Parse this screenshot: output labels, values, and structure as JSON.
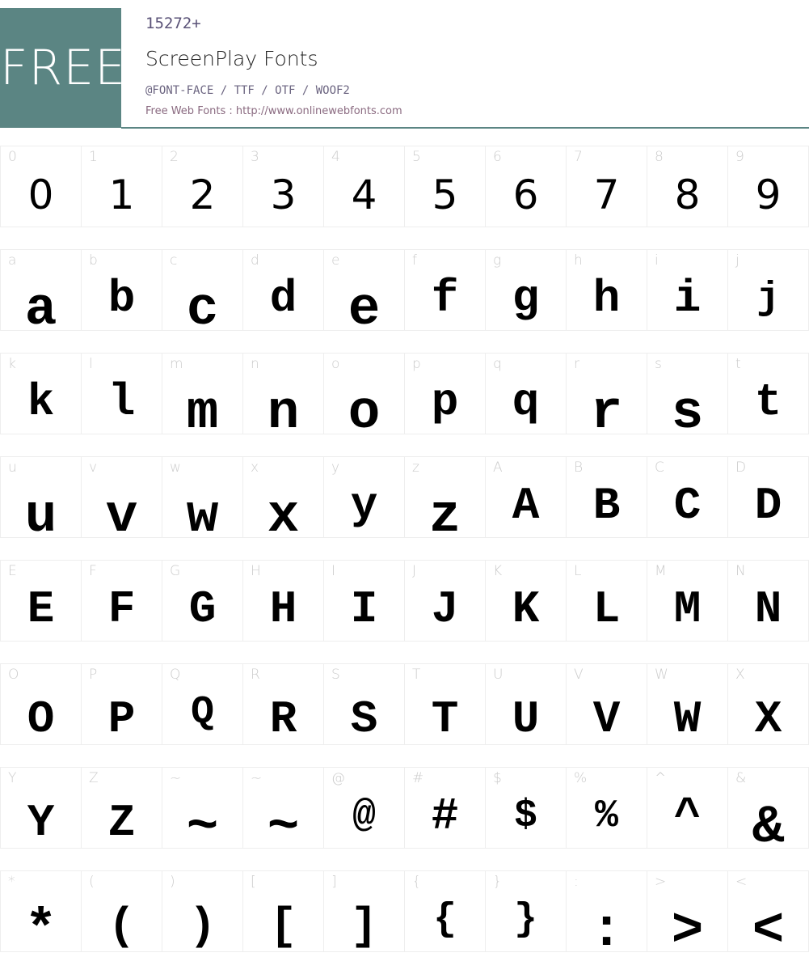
{
  "header": {
    "badge": "FREE",
    "count": "15272+",
    "title": "ScreenPlay Fonts",
    "formats": "@FONT-FACE / TTF / OTF / WOOF2",
    "site_link": "Free Web Fonts : http://www.onlinewebfonts.com"
  },
  "colors": {
    "accent": "#5b8583",
    "label": "#cccccc",
    "glyph": "#000000"
  },
  "rows": [
    [
      {
        "l": "0",
        "g": "0",
        "s": "digit"
      },
      {
        "l": "1",
        "g": "1",
        "s": "digit"
      },
      {
        "l": "2",
        "g": "2",
        "s": "digit"
      },
      {
        "l": "3",
        "g": "3",
        "s": "digit"
      },
      {
        "l": "4",
        "g": "4",
        "s": "digit"
      },
      {
        "l": "5",
        "g": "5",
        "s": "digit"
      },
      {
        "l": "6",
        "g": "6",
        "s": "digit"
      },
      {
        "l": "7",
        "g": "7",
        "s": "digit"
      },
      {
        "l": "8",
        "g": "8",
        "s": "digit"
      },
      {
        "l": "9",
        "g": "9",
        "s": "digit"
      }
    ],
    [
      {
        "l": "a",
        "g": "a",
        "s": "big"
      },
      {
        "l": "b",
        "g": "b",
        "s": ""
      },
      {
        "l": "c",
        "g": "c",
        "s": "big"
      },
      {
        "l": "d",
        "g": "d",
        "s": ""
      },
      {
        "l": "e",
        "g": "e",
        "s": "big"
      },
      {
        "l": "f",
        "g": "f",
        "s": ""
      },
      {
        "l": "g",
        "g": "g",
        "s": ""
      },
      {
        "l": "h",
        "g": "h",
        "s": ""
      },
      {
        "l": "i",
        "g": "i",
        "s": ""
      },
      {
        "l": "j",
        "g": "j",
        "s": "small"
      }
    ],
    [
      {
        "l": "k",
        "g": "k",
        "s": ""
      },
      {
        "l": "l",
        "g": "l",
        "s": ""
      },
      {
        "l": "m",
        "g": "m",
        "s": "big"
      },
      {
        "l": "n",
        "g": "n",
        "s": "big"
      },
      {
        "l": "o",
        "g": "o",
        "s": "big"
      },
      {
        "l": "p",
        "g": "p",
        "s": ""
      },
      {
        "l": "q",
        "g": "q",
        "s": ""
      },
      {
        "l": "r",
        "g": "r",
        "s": "big"
      },
      {
        "l": "s",
        "g": "s",
        "s": "big"
      },
      {
        "l": "t",
        "g": "t",
        "s": ""
      }
    ],
    [
      {
        "l": "u",
        "g": "u",
        "s": "big"
      },
      {
        "l": "v",
        "g": "v",
        "s": "big"
      },
      {
        "l": "w",
        "g": "w",
        "s": "big"
      },
      {
        "l": "x",
        "g": "x",
        "s": "big"
      },
      {
        "l": "y",
        "g": "y",
        "s": ""
      },
      {
        "l": "z",
        "g": "z",
        "s": "big"
      },
      {
        "l": "A",
        "g": "A",
        "s": ""
      },
      {
        "l": "B",
        "g": "B",
        "s": ""
      },
      {
        "l": "C",
        "g": "C",
        "s": ""
      },
      {
        "l": "D",
        "g": "D",
        "s": ""
      }
    ],
    [
      {
        "l": "E",
        "g": "E",
        "s": ""
      },
      {
        "l": "F",
        "g": "F",
        "s": ""
      },
      {
        "l": "G",
        "g": "G",
        "s": ""
      },
      {
        "l": "H",
        "g": "H",
        "s": ""
      },
      {
        "l": "I",
        "g": "I",
        "s": ""
      },
      {
        "l": "J",
        "g": "J",
        "s": ""
      },
      {
        "l": "K",
        "g": "K",
        "s": ""
      },
      {
        "l": "L",
        "g": "L",
        "s": ""
      },
      {
        "l": "M",
        "g": "M",
        "s": ""
      },
      {
        "l": "N",
        "g": "N",
        "s": ""
      }
    ],
    [
      {
        "l": "O",
        "g": "O",
        "s": "low"
      },
      {
        "l": "P",
        "g": "P",
        "s": "low"
      },
      {
        "l": "Q",
        "g": "Q",
        "s": "small"
      },
      {
        "l": "R",
        "g": "R",
        "s": "low"
      },
      {
        "l": "S",
        "g": "S",
        "s": "low"
      },
      {
        "l": "T",
        "g": "T",
        "s": "low"
      },
      {
        "l": "U",
        "g": "U",
        "s": "low"
      },
      {
        "l": "V",
        "g": "V",
        "s": "low"
      },
      {
        "l": "W",
        "g": "W",
        "s": "low"
      },
      {
        "l": "X",
        "g": "X",
        "s": "low"
      }
    ],
    [
      {
        "l": "Y",
        "g": "Y",
        "s": "low"
      },
      {
        "l": "Z",
        "g": "Z",
        "s": "low"
      },
      {
        "l": "~",
        "g": "~",
        "s": "big"
      },
      {
        "l": "~",
        "g": "~",
        "s": "big"
      },
      {
        "l": "@",
        "g": "@",
        "s": "small"
      },
      {
        "l": "#",
        "g": "#",
        "s": ""
      },
      {
        "l": "$",
        "g": "$",
        "s": "small"
      },
      {
        "l": "%",
        "g": "%",
        "s": "small"
      },
      {
        "l": "^",
        "g": "^",
        "s": ""
      },
      {
        "l": "&",
        "g": "&",
        "s": "big"
      }
    ],
    [
      {
        "l": "*",
        "g": "*",
        "s": "big"
      },
      {
        "l": "(",
        "g": "(",
        "s": "low"
      },
      {
        "l": ")",
        "g": ")",
        "s": "low"
      },
      {
        "l": "[",
        "g": "[",
        "s": "low"
      },
      {
        "l": "]",
        "g": "]",
        "s": "low"
      },
      {
        "l": "{",
        "g": "{",
        "s": "small"
      },
      {
        "l": "}",
        "g": "}",
        "s": "small"
      },
      {
        "l": ":",
        "g": ":",
        "s": "big"
      },
      {
        "l": ">",
        "g": ">",
        "s": "big"
      },
      {
        "l": "<",
        "g": "<",
        "s": "big"
      }
    ]
  ]
}
